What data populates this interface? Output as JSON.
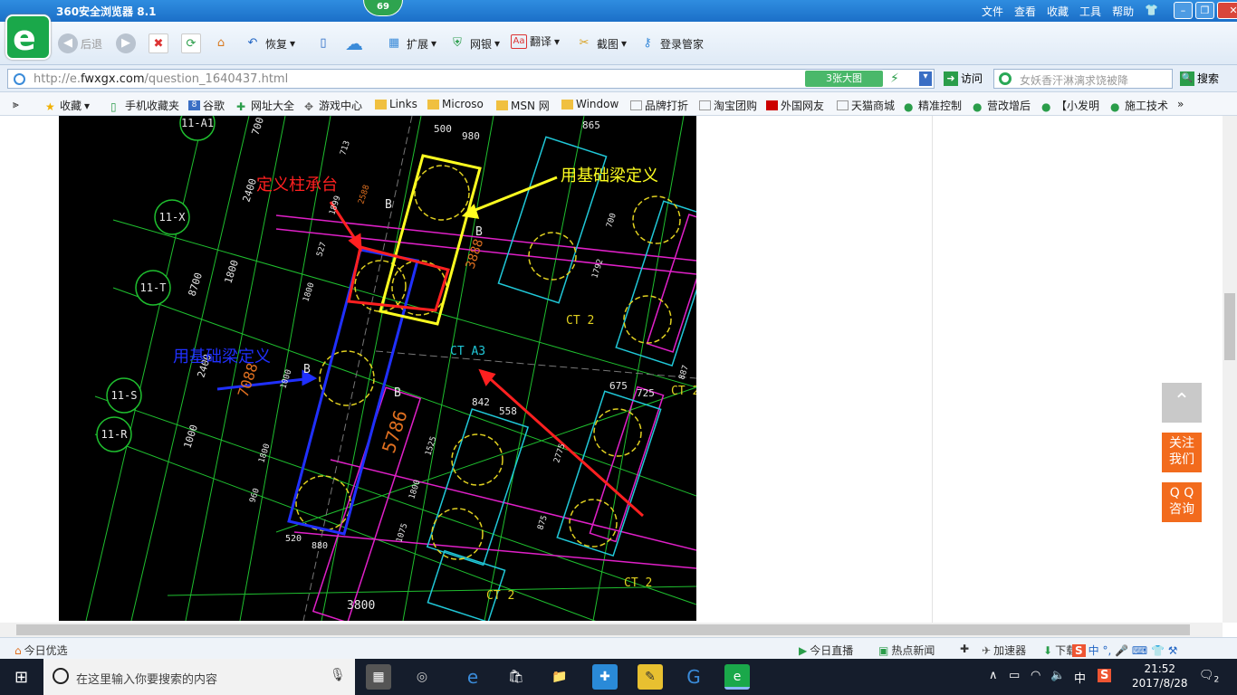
{
  "title_bar": {
    "title": "360安全浏览器 8.1",
    "badge": "69",
    "menus": [
      "文件",
      "查看",
      "收藏",
      "工具",
      "帮助"
    ],
    "logo_letter": "e"
  },
  "toolbar": {
    "back": "后退",
    "restore": "恢复",
    "extend": "扩展",
    "netbank": "网银",
    "translate": "翻译",
    "screenshot": "截图",
    "login": "登录管家"
  },
  "address": {
    "url_prefix": "http://e.",
    "url_domain": "fwxgx.com",
    "url_path": "/question_1640437.html",
    "big_image": "3张大图",
    "visit": "访问",
    "search_placeholder": "女妖香汗淋漓求饶被降",
    "search_button": "搜索"
  },
  "favorites": [
    "收藏",
    "手机收藏夹",
    "谷歌",
    "网址大全",
    "游戏中心",
    "Links",
    "Microso",
    "MSN 网",
    "Window",
    "品牌打折",
    "淘宝团购",
    "外国网友",
    "天猫商城",
    "精准控制",
    "营改增后",
    "【小发明",
    "施工技术"
  ],
  "cad": {
    "label_red": "定义柱承台",
    "label_yellow": "用基础梁定义",
    "label_blue": "用基础梁定义",
    "axis_labels": [
      "11-A1",
      "11-X",
      "11-T",
      "11-S",
      "11-R"
    ],
    "dims": [
      "700",
      "2400",
      "713",
      "2588",
      "500",
      "980",
      "865",
      "1899",
      "527",
      "1800",
      "8700",
      "1800",
      "7088",
      "2400",
      "1000",
      "1000",
      "960",
      "1800",
      "520",
      "880",
      "3800",
      "3888",
      "700",
      "1792",
      "5786",
      "842",
      "558",
      "1525",
      "1800",
      "1075",
      "675",
      "725",
      "2775",
      "875",
      "887"
    ],
    "tags": [
      "CT A3",
      "CT 2",
      "CT 2",
      "CT 2",
      "CT 2",
      "B",
      "B",
      "B",
      "B",
      "B"
    ]
  },
  "side_buttons": {
    "follow": [
      "关注",
      "我们"
    ],
    "qq": [
      "Q Q",
      "咨询"
    ]
  },
  "status": {
    "today_pick": "今日优选",
    "today_live": "今日直播",
    "hot_news": "热点新闻",
    "accelerator": "加速器",
    "download": "下载"
  },
  "taskbar": {
    "search_placeholder": "在这里输入你要搜索的内容",
    "time": "21:52",
    "date": "2017/8/28",
    "ime": "中",
    "notifications": "2"
  },
  "colors": {
    "title_bar": "#1b6fc8",
    "logo_green": "#1aa84a",
    "side_orange": "#f26b1d",
    "side_gray": "#c9c9c9",
    "cad_bg": "#000000"
  }
}
